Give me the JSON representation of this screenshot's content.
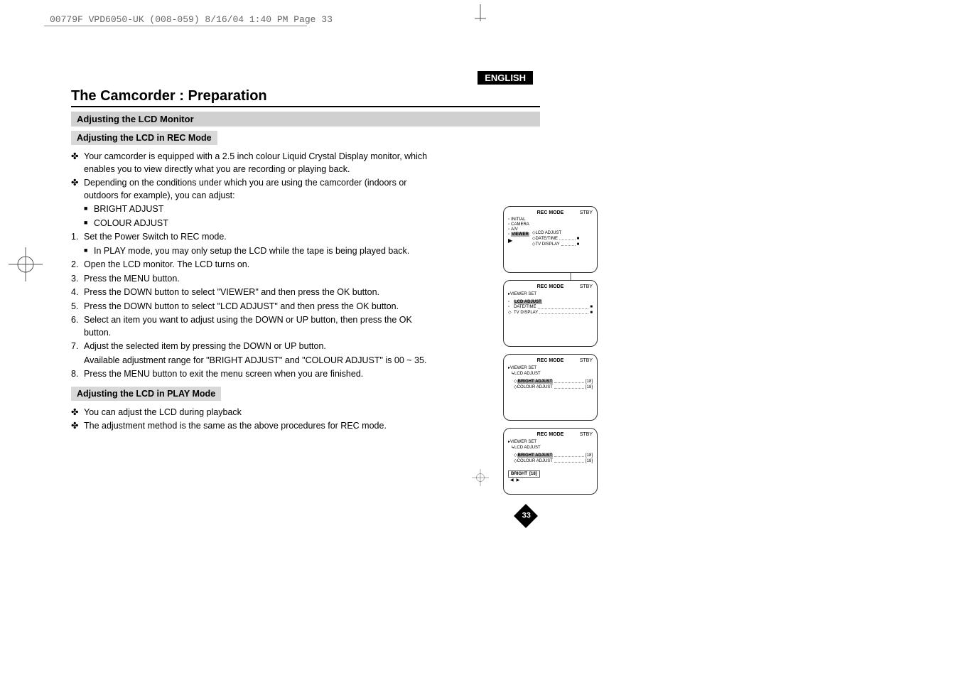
{
  "meta_header": "00779F VPD6050-UK (008-059)  8/16/04 1:40 PM  Page 33",
  "language_badge": "ENGLISH",
  "page_title": "The Camcorder : Preparation",
  "section_title": "Adjusting the LCD Monitor",
  "rec_mode": {
    "heading": "Adjusting the LCD in REC Mode",
    "bullets": [
      "Your camcorder is equipped with a 2.5 inch colour Liquid Crystal Display monitor, which enables you to view directly what you are recording or playing back.",
      "Depending on the conditions under which you are using the camcorder (indoors or outdoors for example), you can adjust:"
    ],
    "sub_bullets": [
      "BRIGHT ADJUST",
      "COLOUR ADJUST"
    ],
    "steps": [
      "Set the Power Switch to REC mode.",
      "Open the LCD monitor. The LCD turns on.",
      "Press the MENU button.",
      "Press the DOWN button to select \"VIEWER\" and then press the OK button.",
      "Press the DOWN button to select \"LCD ADJUST\" and then press the OK button.",
      "Select an item you want to adjust using the DOWN or UP button, then press the OK button.",
      "Adjust the selected item by pressing the DOWN or UP button.",
      "Press the MENU button to exit the menu screen when you are finished."
    ],
    "step1_sub": "In PLAY mode, you may only setup the LCD while the tape is being played back.",
    "step7_sub": "Available adjustment range for \"BRIGHT ADJUST\" and \"COLOUR ADJUST\" is 00 ~ 35."
  },
  "play_mode": {
    "heading": "Adjusting the LCD in PLAY Mode",
    "bullets": [
      "You can adjust the LCD during playback",
      "The adjustment method is the same as the above procedures for REC mode."
    ]
  },
  "page_number": "33",
  "menus": {
    "mode_label": "REC MODE",
    "stby": "STBY",
    "m1": {
      "items": [
        "INITIAL",
        "CAMERA",
        "A/V",
        "VIEWER"
      ],
      "right": [
        "LCD ADJUST",
        "DATE/TIME",
        "TV DISPLAY"
      ]
    },
    "m2": {
      "viewer_set": "VIEWER SET",
      "items": [
        "LCD ADJUST",
        "DATE/TIME",
        "TV DISPLAY"
      ]
    },
    "m3": {
      "viewer_set": "VIEWER SET",
      "lcd_adjust": "LCD ADJUST",
      "items": [
        {
          "label": "BRIGHT ADJUST",
          "val": "[18]"
        },
        {
          "label": "COLOUR ADJUST",
          "val": "[18]"
        }
      ]
    },
    "m4": {
      "viewer_set": "VIEWER SET",
      "lcd_adjust": "LCD ADJUST",
      "items": [
        {
          "label": "BRIGHT ADJUST",
          "val": "[18]"
        },
        {
          "label": "COLOUR ADJUST",
          "val": "[18]"
        }
      ],
      "slider": {
        "label": "BRIGHT",
        "val": "[18]"
      }
    }
  }
}
